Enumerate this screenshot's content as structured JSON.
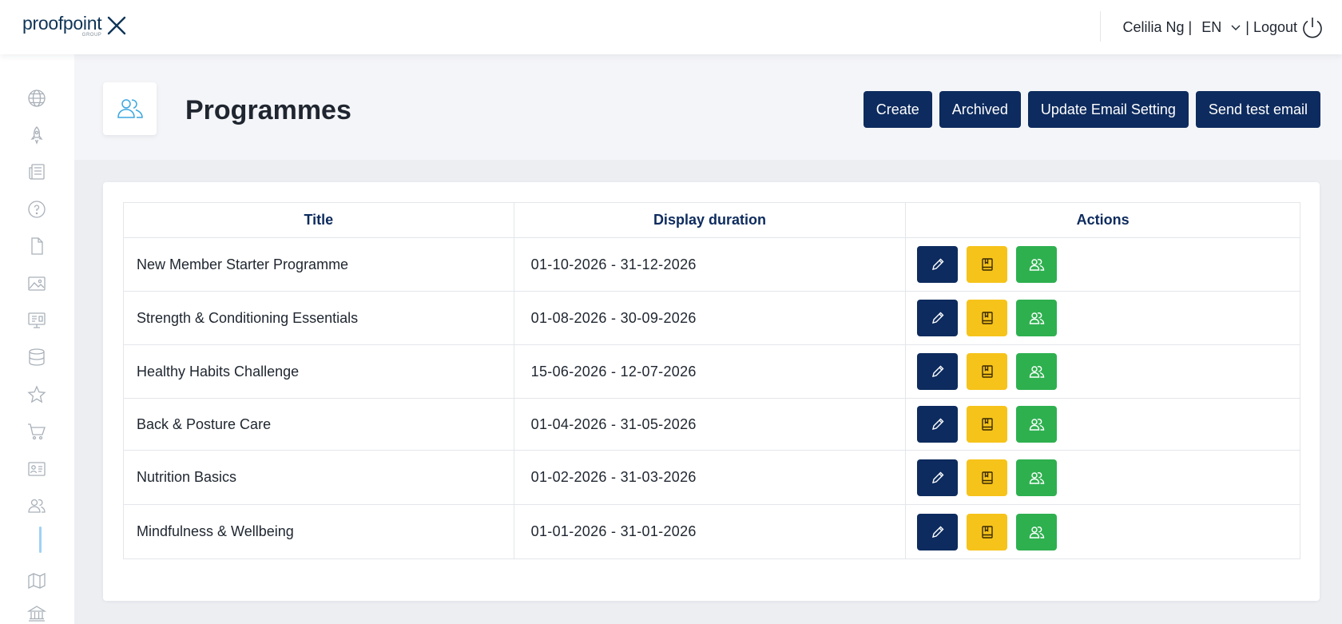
{
  "brand": {
    "name": "proofpoint",
    "sub": "GROUP"
  },
  "header": {
    "user_name": "Celilia Ng |",
    "language": "EN",
    "logout_label": "| Logout"
  },
  "sidebar": {
    "items": [
      {
        "icon": "globe-icon"
      },
      {
        "icon": "rocket-icon"
      },
      {
        "icon": "newspaper-icon"
      },
      {
        "icon": "help-circle-icon"
      },
      {
        "icon": "document-icon"
      },
      {
        "icon": "image-icon"
      },
      {
        "icon": "presentation-icon"
      },
      {
        "icon": "database-icon"
      },
      {
        "icon": "star-icon"
      },
      {
        "icon": "cart-icon"
      },
      {
        "icon": "id-card-icon"
      },
      {
        "icon": "users-icon",
        "active": true
      },
      {
        "icon": "map-icon"
      },
      {
        "icon": "bank-icon"
      }
    ]
  },
  "page": {
    "title": "Programmes",
    "buttons": {
      "create": "Create",
      "archived": "Archived",
      "update_email": "Update Email Setting",
      "send_test": "Send test email"
    }
  },
  "table": {
    "headers": {
      "title": "Title",
      "duration": "Display duration",
      "actions": "Actions"
    },
    "rows": [
      {
        "title": "New Member Starter Programme",
        "duration": "01-10-2026 - 31-12-2026"
      },
      {
        "title": "Strength & Conditioning Essentials",
        "duration": "01-08-2026 - 30-09-2026"
      },
      {
        "title": "Healthy Habits Challenge",
        "duration": "15-06-2026 - 12-07-2026"
      },
      {
        "title": "Back & Posture Care",
        "duration": "01-04-2026 - 31-05-2026"
      },
      {
        "title": "Nutrition Basics",
        "duration": "01-02-2026 - 31-03-2026"
      },
      {
        "title": "Mindfulness & Wellbeing",
        "duration": "01-01-2026 - 31-01-2026"
      }
    ]
  },
  "colors": {
    "primary": "#0d2b5e",
    "warning": "#f6c31b",
    "success": "#2eb04f",
    "accent_light": "#9fd1f4"
  }
}
